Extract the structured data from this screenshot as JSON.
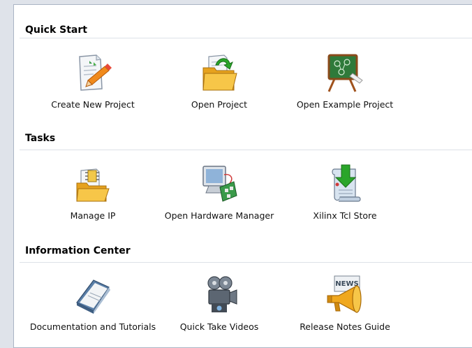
{
  "sections": [
    {
      "title": "Quick Start",
      "items": [
        {
          "label": "Create New Project",
          "icon": "create-new-project-icon"
        },
        {
          "label": "Open Project",
          "icon": "open-project-icon"
        },
        {
          "label": "Open Example Project",
          "icon": "open-example-project-icon"
        }
      ]
    },
    {
      "title": "Tasks",
      "items": [
        {
          "label": "Manage IP",
          "icon": "manage-ip-icon"
        },
        {
          "label": "Open Hardware Manager",
          "icon": "hardware-manager-icon"
        },
        {
          "label": "Xilinx Tcl Store",
          "icon": "tcl-store-icon"
        }
      ]
    },
    {
      "title": "Information Center",
      "items": [
        {
          "label": "Documentation and Tutorials",
          "icon": "documentation-icon"
        },
        {
          "label": "Quick Take Videos",
          "icon": "video-camera-icon"
        },
        {
          "label": "Release Notes Guide",
          "icon": "megaphone-icon"
        }
      ]
    }
  ],
  "icon_text": {
    "news": "NEWS"
  },
  "colors": {
    "panel_border": "#aab4c4",
    "divider": "#dde1e7",
    "folder": "#f2b233",
    "chalkboard": "#2f7a3a",
    "green_arrow": "#2aa52a"
  }
}
